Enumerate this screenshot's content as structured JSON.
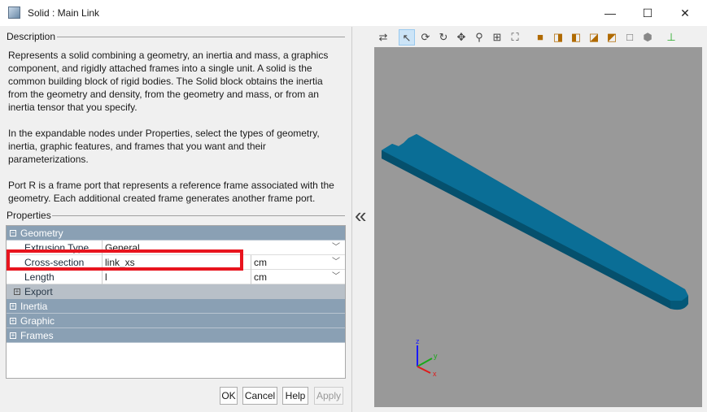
{
  "window": {
    "title": "Solid : Main Link",
    "minimize": "—",
    "maximize": "☐",
    "close": "✕"
  },
  "description": {
    "label": "Description",
    "paragraphs": [
      "Represents a solid combining a geometry, an inertia and mass, a graphics component, and rigidly attached frames into a single unit. A solid is the common building block of rigid bodies. The Solid block obtains the inertia from the geometry and density, from the geometry and mass, or from an inertia tensor that you specify.",
      "In the expandable nodes under Properties, select the types of geometry, inertia, graphic features, and frames that you want and their parameterizations.",
      "Port R is a frame port that represents a reference frame associated with the geometry. Each additional created frame generates another frame port."
    ]
  },
  "properties": {
    "label": "Properties",
    "geometry": {
      "label": "Geometry",
      "extrusion_type": {
        "label": "Extrusion Type",
        "value": "General"
      },
      "cross_section": {
        "label": "Cross-section",
        "value": "link_xs",
        "unit": "cm"
      },
      "length": {
        "label": "Length",
        "value": "l",
        "unit": "cm"
      },
      "export": {
        "label": "Export"
      }
    },
    "inertia": {
      "label": "Inertia"
    },
    "graphic": {
      "label": "Graphic"
    },
    "frames": {
      "label": "Frames"
    }
  },
  "buttons": {
    "ok": "OK",
    "cancel": "Cancel",
    "help": "Help",
    "apply": "Apply"
  },
  "collapse": "«",
  "axes": {
    "x": "x",
    "y": "y",
    "z": "z"
  },
  "colors": {
    "highlight": "#e8141e",
    "solid": "#0a6e96",
    "view_bg": "#999999"
  }
}
